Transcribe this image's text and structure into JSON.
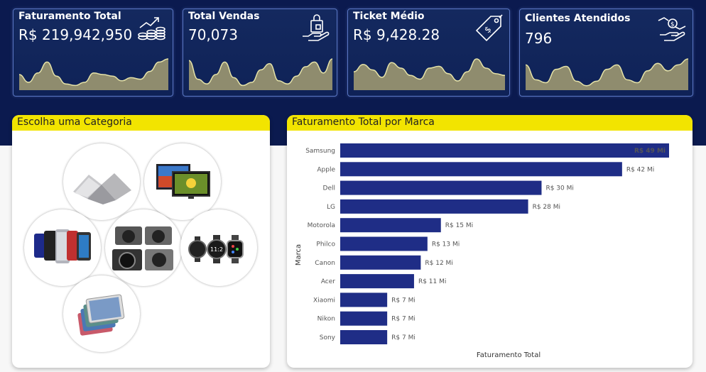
{
  "kpis": [
    {
      "title": "Faturamento Total",
      "value": "R$ 219,942,950",
      "icon": "money-growth-icon",
      "spark": [
        20,
        10,
        22,
        36,
        18,
        8,
        6,
        10,
        22,
        20,
        18,
        12,
        16,
        14,
        24,
        36,
        40
      ]
    },
    {
      "title": "Total Vendas",
      "value": "70,073",
      "icon": "shopping-bag-hand-icon",
      "spark": [
        38,
        14,
        8,
        20,
        36,
        16,
        6,
        10,
        26,
        34,
        12,
        8,
        18,
        30,
        36,
        22,
        40
      ]
    },
    {
      "title": "Ticket Médio",
      "value": "R$ 9,428.28",
      "icon": "price-tag-icon",
      "spark": [
        20,
        28,
        22,
        14,
        30,
        24,
        16,
        12,
        24,
        26,
        18,
        10,
        20,
        34,
        24,
        18,
        16
      ]
    },
    {
      "title": "Clientes Atendidos",
      "value": "796",
      "icon": "hand-coin-icon",
      "spark": [
        34,
        14,
        10,
        28,
        32,
        12,
        6,
        12,
        28,
        34,
        14,
        10,
        26,
        36,
        26,
        34,
        42
      ]
    }
  ],
  "category_panel": {
    "title": "Escolha uma Categoria",
    "items": [
      {
        "name": "category-laptops",
        "icon": "laptop-icon"
      },
      {
        "name": "category-tvs",
        "icon": "tv-icon"
      },
      {
        "name": "category-smartphones",
        "icon": "smartphone-icon"
      },
      {
        "name": "category-cameras",
        "icon": "camera-icon"
      },
      {
        "name": "category-smartwatches",
        "icon": "smartwatch-icon"
      },
      {
        "name": "category-tablets",
        "icon": "tablet-icon"
      }
    ]
  },
  "chart_panel": {
    "title": "Faturamento Total por Marca"
  },
  "colors": {
    "banner": "#0b1a4f",
    "accent": "#f2e400",
    "bar": "#1f2d86",
    "spark_fill": "#8f8c6e",
    "spark_line": "#e6e3a8"
  },
  "chart_data": {
    "type": "bar",
    "orientation": "horizontal",
    "title": "Faturamento Total por Marca",
    "xlabel": "Faturamento Total",
    "ylabel": "Marca",
    "categories": [
      "Samsung",
      "Apple",
      "Dell",
      "LG",
      "Motorola",
      "Philco",
      "Canon",
      "Acer",
      "Xiaomi",
      "Nikon",
      "Sony"
    ],
    "values": [
      49,
      42,
      30,
      28,
      15,
      13,
      12,
      11,
      7,
      7,
      7
    ],
    "labels": [
      "R$ 49 Mi",
      "R$ 42 Mi",
      "R$ 30 Mi",
      "R$ 28 Mi",
      "R$ 15 Mi",
      "R$ 13 Mi",
      "R$ 12 Mi",
      "R$ 11 Mi",
      "R$ 7 Mi",
      "R$ 7 Mi",
      "R$ 7 Mi"
    ],
    "unit": "R$ Mi",
    "grid": false
  }
}
